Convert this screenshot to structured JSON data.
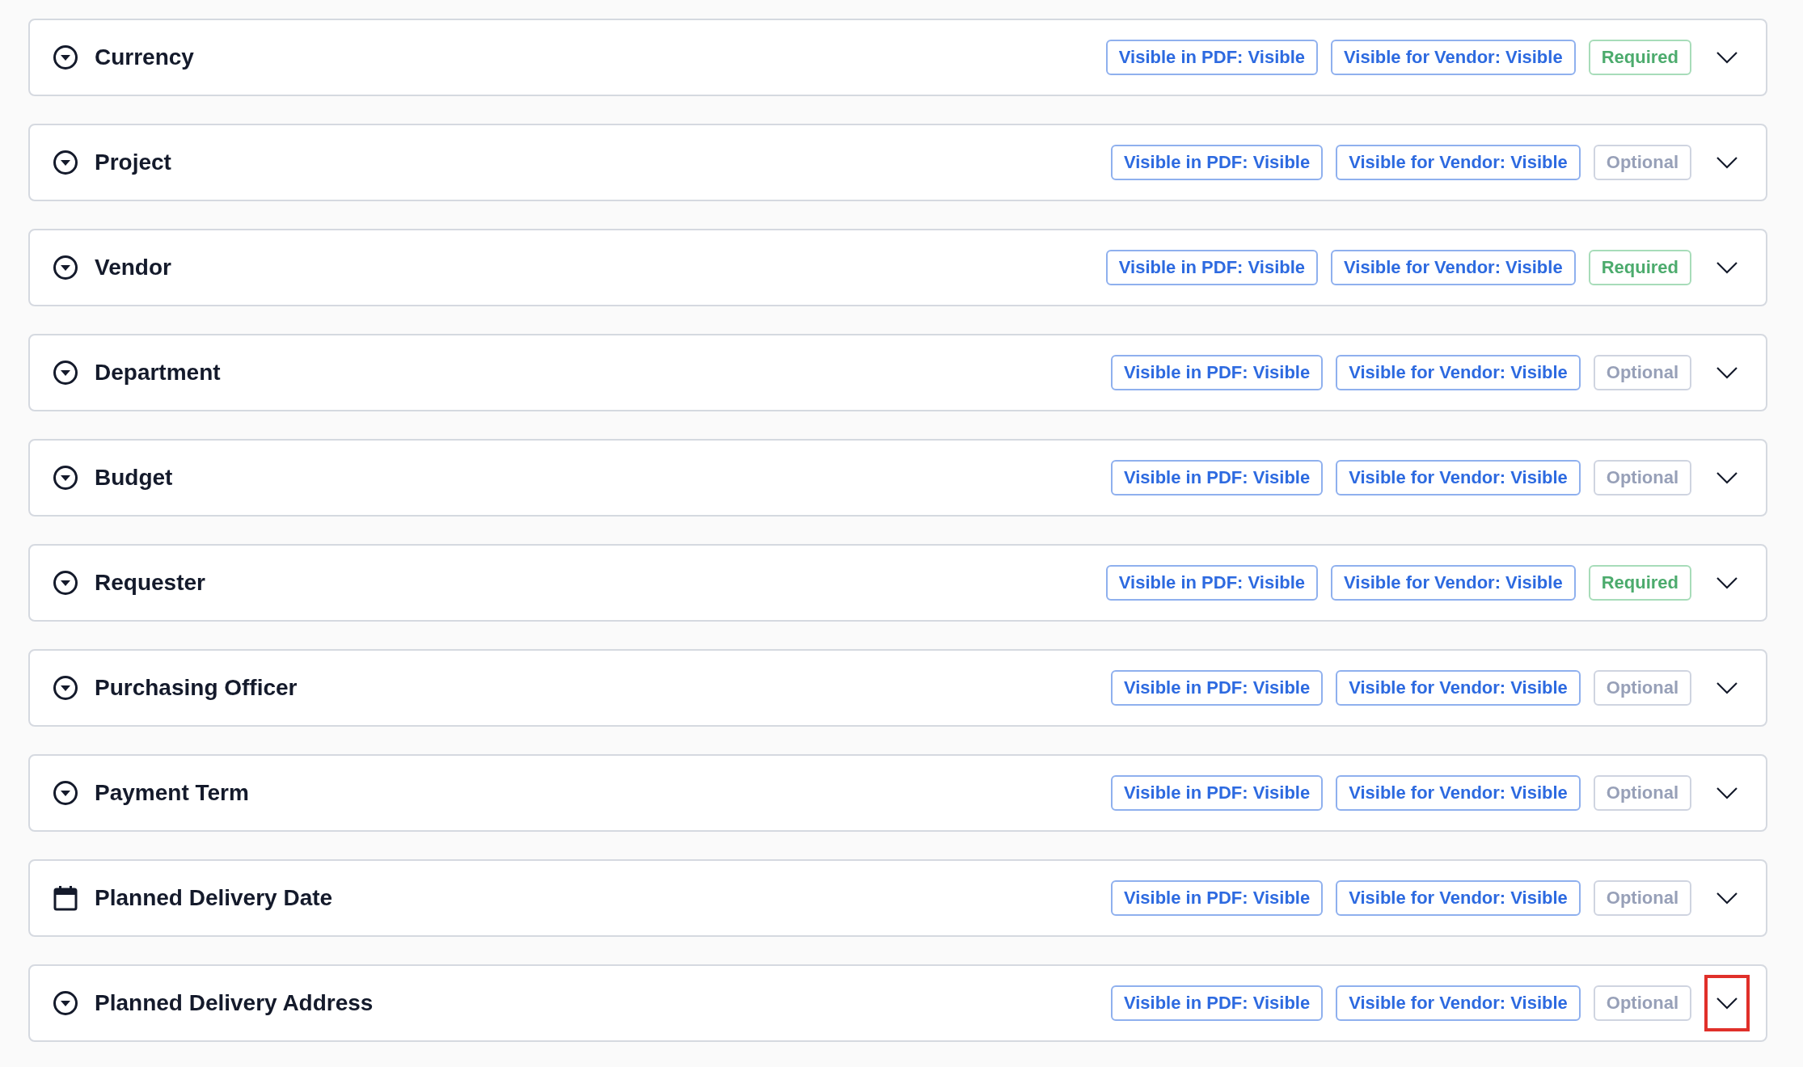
{
  "fields": [
    {
      "kind": "select",
      "title": "Currency",
      "pdf": "Visible in PDF: Visible",
      "vendor": "Visible for Vendor: Visible",
      "requirement": {
        "label": "Required",
        "kind": "required"
      },
      "highlighted": false
    },
    {
      "kind": "select",
      "title": "Project",
      "pdf": "Visible in PDF: Visible",
      "vendor": "Visible for Vendor: Visible",
      "requirement": {
        "label": "Optional",
        "kind": "optional"
      },
      "highlighted": false
    },
    {
      "kind": "select",
      "title": "Vendor",
      "pdf": "Visible in PDF: Visible",
      "vendor": "Visible for Vendor: Visible",
      "requirement": {
        "label": "Required",
        "kind": "required"
      },
      "highlighted": false
    },
    {
      "kind": "select",
      "title": "Department",
      "pdf": "Visible in PDF: Visible",
      "vendor": "Visible for Vendor: Visible",
      "requirement": {
        "label": "Optional",
        "kind": "optional"
      },
      "highlighted": false
    },
    {
      "kind": "select",
      "title": "Budget",
      "pdf": "Visible in PDF: Visible",
      "vendor": "Visible for Vendor: Visible",
      "requirement": {
        "label": "Optional",
        "kind": "optional"
      },
      "highlighted": false
    },
    {
      "kind": "select",
      "title": "Requester",
      "pdf": "Visible in PDF: Visible",
      "vendor": "Visible for Vendor: Visible",
      "requirement": {
        "label": "Required",
        "kind": "required"
      },
      "highlighted": false
    },
    {
      "kind": "select",
      "title": "Purchasing Officer",
      "pdf": "Visible in PDF: Visible",
      "vendor": "Visible for Vendor: Visible",
      "requirement": {
        "label": "Optional",
        "kind": "optional"
      },
      "highlighted": false
    },
    {
      "kind": "select",
      "title": "Payment Term",
      "pdf": "Visible in PDF: Visible",
      "vendor": "Visible for Vendor: Visible",
      "requirement": {
        "label": "Optional",
        "kind": "optional"
      },
      "highlighted": false
    },
    {
      "kind": "date",
      "title": "Planned Delivery Date",
      "pdf": "Visible in PDF: Visible",
      "vendor": "Visible for Vendor: Visible",
      "requirement": {
        "label": "Optional",
        "kind": "optional"
      },
      "highlighted": false
    },
    {
      "kind": "select",
      "title": "Planned Delivery Address",
      "pdf": "Visible in PDF: Visible",
      "vendor": "Visible for Vendor: Visible",
      "requirement": {
        "label": "Optional",
        "kind": "optional"
      },
      "highlighted": true
    }
  ]
}
